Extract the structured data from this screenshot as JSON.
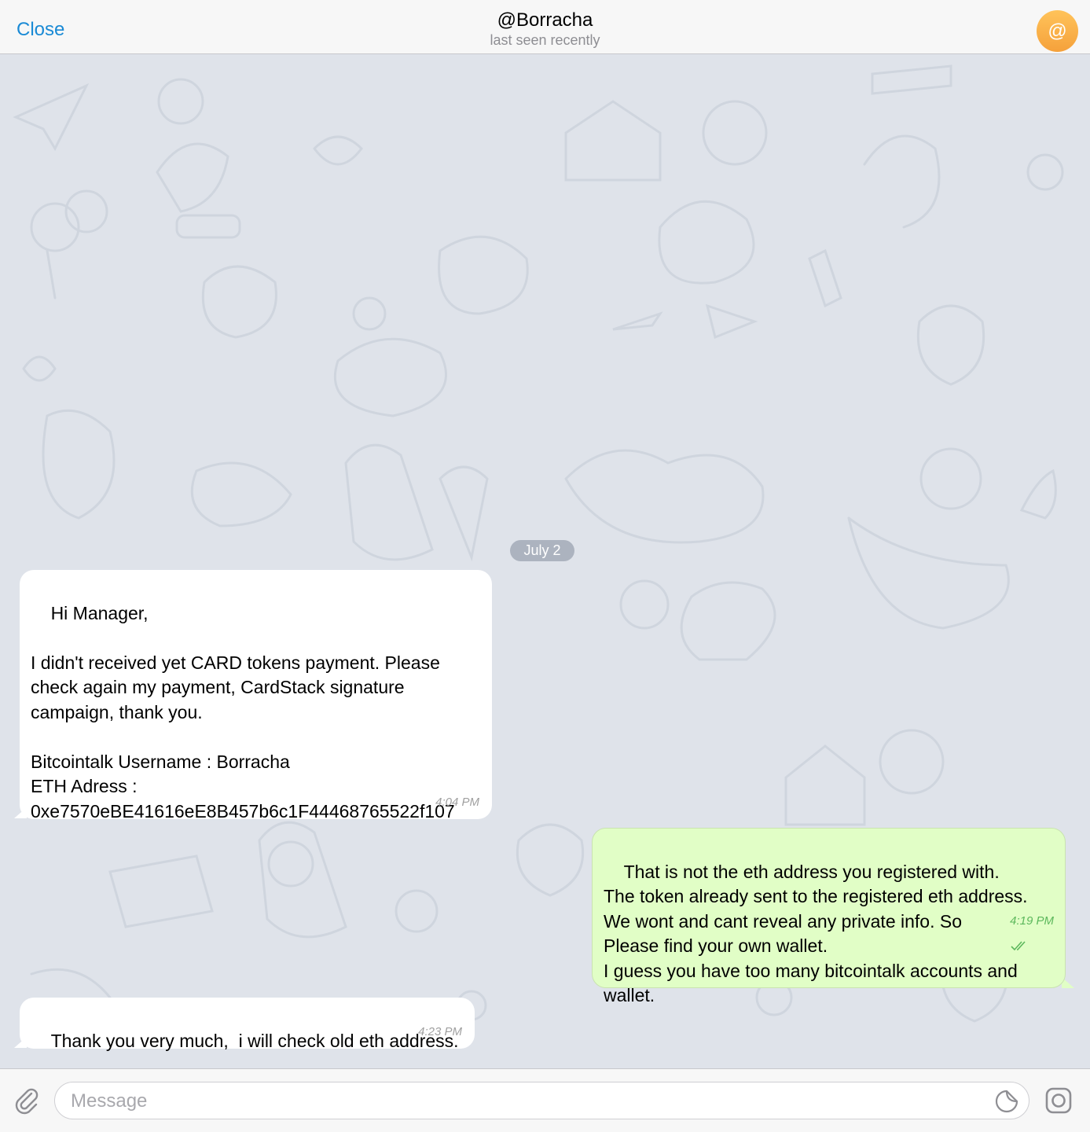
{
  "header": {
    "close_label": "Close",
    "title": "@Borracha",
    "status": "last seen recently",
    "avatar_text": "@",
    "avatar_color": "#f7a83d",
    "accent_color": "#1a8ad5"
  },
  "chat": {
    "date_label": "July 2",
    "messages": [
      {
        "direction": "incoming",
        "text": "Hi Manager,\n\nI didn't received yet CARD tokens payment. Please check again my payment, CardStack signature campaign, thank you.\n\nBitcointalk Username : Borracha\nETH Adress :\n0xe7570eBE41616eE8B457b6c1F44468765522f107",
        "time": "4:04 PM"
      },
      {
        "direction": "outgoing",
        "text": "That is not the eth address you registered with.\nThe token already sent to the registered eth address.\nWe wont and cant reveal any private info. So\nPlease find your own wallet.\nI guess you have too many bitcointalk accounts and wallet.",
        "time": "4:19 PM",
        "status_icon": "double-check-icon"
      },
      {
        "direction": "incoming",
        "text": "Thank you very much,  i will check old eth address.",
        "time": "4:23 PM"
      }
    ]
  },
  "input": {
    "placeholder": "Message",
    "value": "",
    "attach_icon": "paperclip-icon",
    "sticker_icon": "sticker-icon",
    "camera_icon": "camera-icon"
  }
}
